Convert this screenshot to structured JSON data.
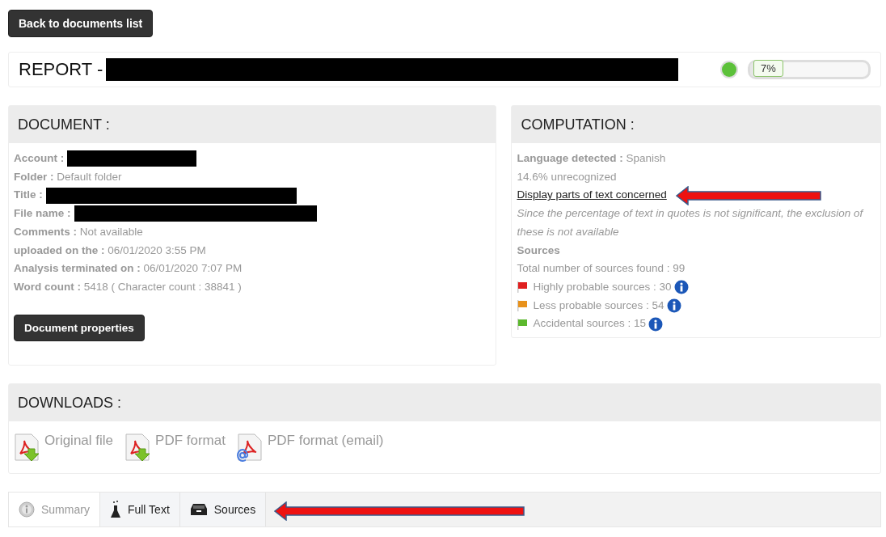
{
  "back_button": "Back to documents list",
  "report": {
    "title": "REPORT -",
    "title_redacted": true,
    "progress": {
      "level": 0.07,
      "label": "7%"
    }
  },
  "document": {
    "heading": "DOCUMENT :",
    "fields": [
      {
        "label": "Account :",
        "redacted": true
      },
      {
        "label": "Folder :",
        "value": "Default folder"
      },
      {
        "label": "Title :",
        "redacted": true
      },
      {
        "label": "File name :",
        "redacted": true
      },
      {
        "label": "Comments :",
        "value": "Not available"
      },
      {
        "label": "uploaded on the :",
        "value": "06/01/2020 3:55 PM"
      },
      {
        "label": "Analysis terminated on :",
        "value": "06/01/2020 7:07 PM"
      },
      {
        "label": "Word count :",
        "value": "5418 ( Character count : 38841 )"
      }
    ],
    "button": "Document properties"
  },
  "computation": {
    "heading": "COMPUTATION :",
    "language": {
      "label": "Language detected :",
      "value": "Spanish"
    },
    "unrecognized": "14.6% unrecognized",
    "link": "Display parts of text concerned",
    "note": "Since the percentage of text in quotes is not significant, the exclusion of these is not available",
    "sources_heading": "Sources",
    "total": "Total number of sources found : 99",
    "sources": [
      {
        "label": "Highly probable sources : 30",
        "color": "#e02020"
      },
      {
        "label": "Less probable sources : 54",
        "color": "#e8921c"
      },
      {
        "label": "Accidental sources : 15",
        "color": "#5cb82e"
      }
    ]
  },
  "downloads": {
    "heading": "DOWNLOADS :",
    "items": [
      {
        "label": "Original file",
        "kind": "download"
      },
      {
        "label": "PDF format",
        "kind": "download"
      },
      {
        "label": "PDF format (email)",
        "kind": "email"
      }
    ]
  },
  "tabs": [
    {
      "label": "Summary",
      "kind": "info",
      "selected": true
    },
    {
      "label": "Full Text",
      "kind": "flask",
      "selected": false
    },
    {
      "label": "Sources",
      "kind": "tray",
      "selected": false
    }
  ]
}
